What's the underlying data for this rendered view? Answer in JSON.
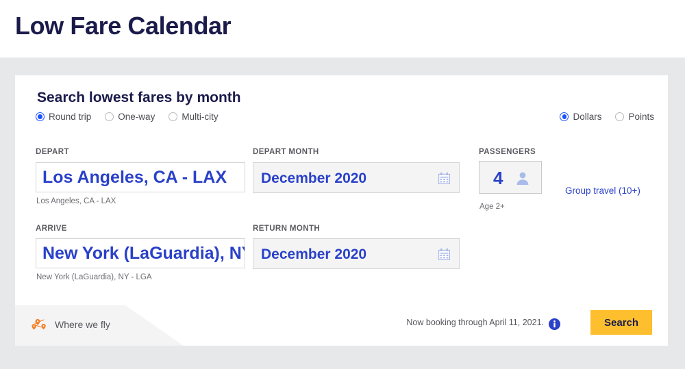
{
  "page": {
    "title": "Low Fare Calendar",
    "background_color": "#e7e8ea",
    "accent_blue": "#2a41c8",
    "accent_yellow": "#fdbf2d",
    "navy": "#1b1b4b"
  },
  "card": {
    "heading": "Search lowest fares by month",
    "trip_type": {
      "options": [
        {
          "label": "Round trip",
          "selected": true
        },
        {
          "label": "One-way",
          "selected": false
        },
        {
          "label": "Multi-city",
          "selected": false
        }
      ]
    },
    "fare_type": {
      "options": [
        {
          "label": "Dollars",
          "selected": true
        },
        {
          "label": "Points",
          "selected": false
        }
      ]
    },
    "fields": {
      "depart": {
        "label": "DEPART",
        "value": "Los Angeles, CA - LAX",
        "helper": "Los Angeles, CA - LAX"
      },
      "arrive": {
        "label": "ARRIVE",
        "value": "New York (LaGuardia), NY - LGA",
        "helper": "New York (LaGuardia), NY - LGA"
      },
      "depart_month": {
        "label": "DEPART MONTH",
        "value": "December 2020",
        "icon": "calendar-icon"
      },
      "return_month": {
        "label": "RETURN MONTH",
        "value": "December 2020",
        "icon": "calendar-icon"
      },
      "passengers": {
        "label": "PASSENGERS",
        "value": "4",
        "helper": "Age 2+",
        "icon": "passenger-icon"
      }
    },
    "group_travel_link": "Group travel (10+)",
    "footer": {
      "where_we_fly": "Where we fly",
      "where_we_fly_icon": "map-pins-icon",
      "booking_note": "Now booking through April 11, 2021.",
      "info_icon": "info-icon",
      "search_button": "Search"
    }
  }
}
